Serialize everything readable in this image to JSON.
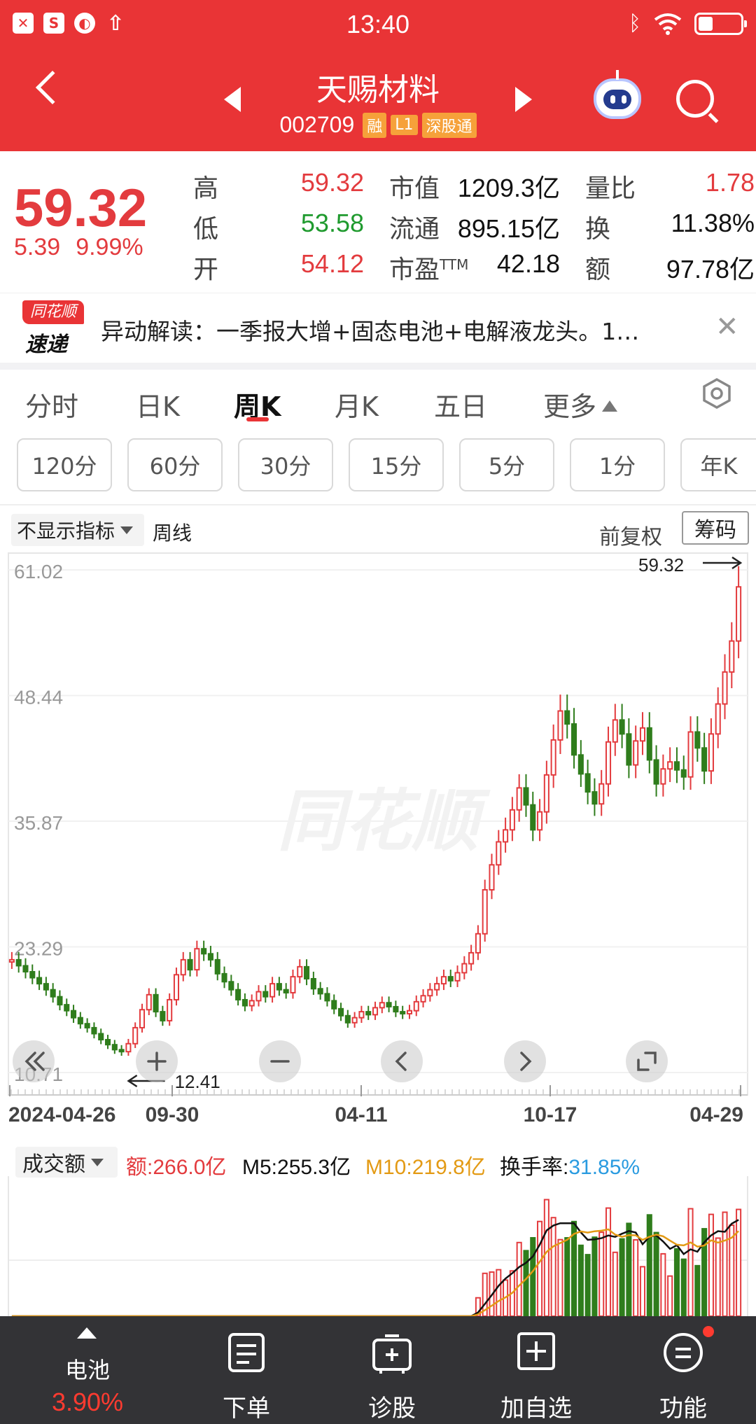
{
  "status_bar": {
    "time": "13:40",
    "left_icons": [
      "x-icon",
      "s-icon",
      "planet-icon",
      "upload-icon"
    ],
    "battery_level": 0.35
  },
  "header": {
    "stock_name": "天赐材料",
    "stock_code": "002709",
    "tags": [
      "融",
      "L1",
      "深股通"
    ],
    "bg_color": "#e93436"
  },
  "quote": {
    "price": "59.32",
    "change": "5.39",
    "change_pct": "9.99%",
    "stats": [
      {
        "label": "高",
        "value": "59.32",
        "color": "red"
      },
      {
        "label": "低",
        "value": "53.58",
        "color": "green"
      },
      {
        "label": "开",
        "value": "54.12",
        "color": "red"
      },
      {
        "label": "市值",
        "value": "1209.3亿",
        "color": "dark"
      },
      {
        "label": "流通",
        "value": "895.15亿",
        "color": "dark"
      },
      {
        "label": "市盈TTM",
        "value": "42.18",
        "color": "dark"
      },
      {
        "label": "量比",
        "value": "1.78",
        "color": "red"
      },
      {
        "label": "换",
        "value": "11.38%",
        "color": "dark"
      },
      {
        "label": "额",
        "value": "97.78亿",
        "color": "dark"
      }
    ]
  },
  "news": {
    "logo_top": "同花顺",
    "logo_bottom": "速递",
    "text": "异动解读：一季报大增+固态电池+电解液龙头。1…"
  },
  "tabs": {
    "items": [
      "分时",
      "日K",
      "周K",
      "月K",
      "五日",
      "更多"
    ],
    "active": "周K"
  },
  "periods": [
    "120分",
    "60分",
    "30分",
    "15分",
    "5分",
    "1分",
    "年K"
  ],
  "chart_controls": {
    "indicator": "不显示指标",
    "line_type": "周线",
    "adjust": "前复权",
    "chip_button": "筹码"
  },
  "chart_data": {
    "type": "candlestick",
    "title": "",
    "y_ticks": [
      "61.02",
      "48.44",
      "35.87",
      "23.29",
      "10.71"
    ],
    "ylim": [
      10.71,
      61.02
    ],
    "x_labels": [
      "2024-04-26",
      "09-30",
      "04-11",
      "10-17",
      "04-29"
    ],
    "max_label": "59.32",
    "min_label": "12.41",
    "watermark": "同花顺",
    "up_color": "#e33b3e",
    "down_color": "#2f7d1c",
    "controls": [
      "rewind-icon",
      "zoom-in-icon",
      "zoom-out-icon",
      "chevron-left-icon",
      "chevron-right-icon",
      "fullscreen-icon"
    ],
    "closes": [
      22.0,
      21.4,
      20.8,
      20.2,
      19.6,
      19.0,
      18.3,
      17.5,
      16.9,
      16.2,
      15.6,
      15.2,
      14.6,
      14.0,
      13.5,
      13.0,
      12.8,
      13.6,
      15.2,
      17.0,
      18.5,
      16.8,
      15.9,
      18.0,
      20.5,
      22.0,
      21.0,
      23.1,
      22.6,
      22.0,
      20.6,
      19.8,
      19.0,
      18.0,
      17.4,
      17.9,
      18.8,
      18.3,
      19.6,
      19.0,
      18.7,
      20.3,
      21.3,
      20.1,
      19.1,
      18.6,
      17.9,
      17.1,
      16.4,
      15.7,
      16.2,
      16.8,
      16.5,
      17.2,
      17.7,
      17.3,
      16.8,
      16.6,
      16.9,
      17.8,
      18.4,
      19.0,
      19.6,
      20.3,
      19.9,
      20.7,
      21.6,
      22.7,
      24.6,
      29.0,
      31.5,
      33.8,
      35.0,
      37.0,
      39.2,
      37.5,
      35.0,
      36.8,
      40.5,
      44.0,
      46.9,
      45.6,
      42.5,
      40.6,
      38.8,
      37.6,
      39.6,
      43.8,
      46.0,
      44.6,
      41.5,
      43.9,
      45.2,
      42.0,
      39.6,
      41.1,
      41.8,
      41.0,
      40.3,
      44.8,
      43.2,
      40.9,
      44.6,
      47.6,
      50.8,
      53.9,
      59.32
    ],
    "vol_stats": {
      "amount_label": "额:266.0亿",
      "m5_label": "M5:255.3亿",
      "m10_label": "M10:219.8亿",
      "turnover_prefix": "换手率:",
      "turnover_value": "31.85%"
    },
    "vol_select": "成交额"
  },
  "bottom_nav": [
    {
      "label": "电池",
      "sub": "3.90%",
      "icon": "up-arrow-icon"
    },
    {
      "label": "下单",
      "icon": "order-icon"
    },
    {
      "label": "诊股",
      "icon": "diagnose-icon"
    },
    {
      "label": "加自选",
      "icon": "add-watchlist-icon"
    },
    {
      "label": "功能",
      "icon": "menu-icon"
    }
  ]
}
